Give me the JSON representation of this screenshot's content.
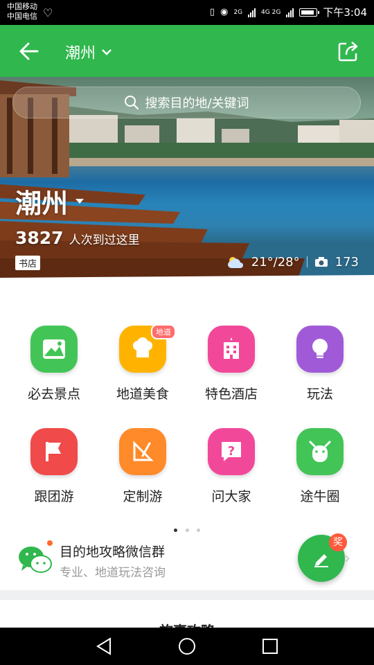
{
  "status_bar": {
    "carrier1": "中国移动",
    "carrier2": "中国电信",
    "net1": "2G",
    "net2": "4G 2G",
    "time": "下午3:04"
  },
  "header": {
    "city": "潮州",
    "bg_color": "#30b74e"
  },
  "hero": {
    "search_placeholder": "搜索目的地/关键词",
    "city": "潮州",
    "visit_count": "3827",
    "visit_text": "人次到过这里",
    "badge": "书店",
    "weather": "21°/28°",
    "photo_count": "173"
  },
  "categories": [
    {
      "label": "必去景点",
      "icon": "landscape-icon",
      "color": "#42c556"
    },
    {
      "label": "地道美食",
      "icon": "chef-hat-icon",
      "color": "#ffb300",
      "tag": "地道"
    },
    {
      "label": "特色酒店",
      "icon": "hotel-icon",
      "color": "#f2489a"
    },
    {
      "label": "玩法",
      "icon": "bulb-icon",
      "color": "#a05ad8"
    },
    {
      "label": "跟团游",
      "icon": "flag-icon",
      "color": "#f04a4a"
    },
    {
      "label": "定制游",
      "icon": "ruler-pen-icon",
      "color": "#ff8a2a"
    },
    {
      "label": "问大家",
      "icon": "question-bubble-icon",
      "color": "#f2489a"
    },
    {
      "label": "途牛圈",
      "icon": "cow-icon",
      "color": "#42c556"
    }
  ],
  "wechat": {
    "title": "目的地攻略微信群",
    "subtitle": "专业、地道玩法咨询"
  },
  "fab": {
    "badge": "奖"
  },
  "next_section_title": "旅事攻略"
}
